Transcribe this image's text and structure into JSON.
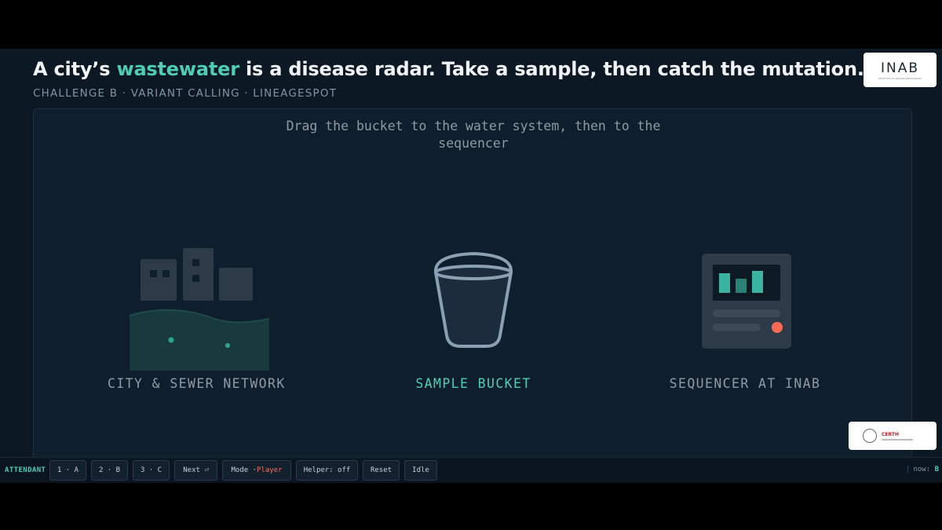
{
  "header": {
    "title_before": "A city’s ",
    "title_highlight": "wastewater",
    "title_after": " is a disease radar. Take a sample, then catch the mutation.",
    "subtitle": "CHALLENGE B · VARIANT CALLING · LINEAGESPOT",
    "logo_text": "INAB",
    "logo_subtext": "INSTITUTE OF APPLIED BIOSCIENCES"
  },
  "stage": {
    "instruction": "Drag the bucket to the water system, then to the sequencer",
    "stations": [
      {
        "label": "CITY & SEWER NETWORK",
        "icon": "city-sewer-icon"
      },
      {
        "label": "SAMPLE BUCKET",
        "icon": "bucket-icon"
      },
      {
        "label": "SEQUENCER AT INAB",
        "icon": "sequencer-icon"
      }
    ]
  },
  "partner_logo": {
    "name": "CERTH"
  },
  "toolbar": {
    "attendant_label": "ATTENDANT",
    "buttons": {
      "one": "1 · A",
      "two": "2 · B",
      "three": "3 · C",
      "next": "Next ⏎",
      "mode_label": "Mode · ",
      "mode_value": "Player",
      "helper": "Helper: off",
      "reset": "Reset",
      "idle": "Idle"
    },
    "now_label": "now:",
    "now_value": "B"
  },
  "colors": {
    "accent": "#4ecdb4",
    "alert": "#ff6b55",
    "background": "#0c1823",
    "panel": "#0f1e2c"
  }
}
